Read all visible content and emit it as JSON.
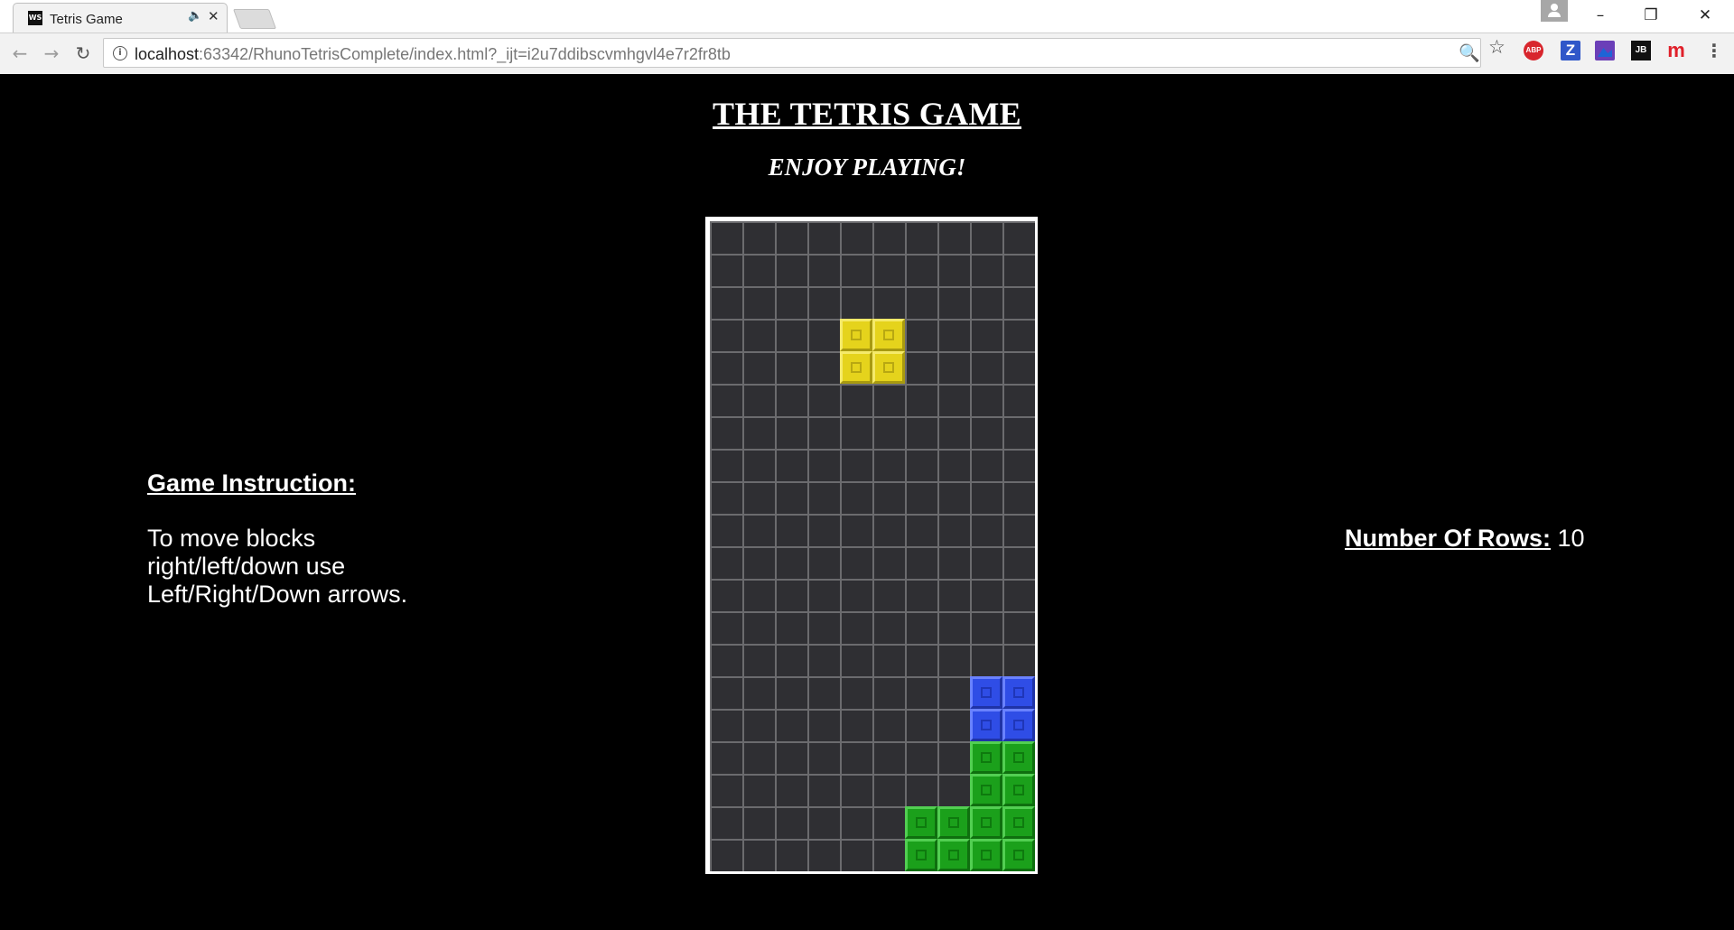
{
  "browser": {
    "tab_title": "Tetris Game",
    "tab_favicon_text": "WS",
    "url_host": "localhost",
    "url_rest": ":63342/RhunoTetrisComplete/index.html?_ijt=i2u7ddibscvmhgvl4e7r2fr8tb",
    "extensions": [
      "ABP",
      "Z",
      "",
      "JB",
      "m"
    ]
  },
  "page": {
    "title": "THE TETRIS GAME",
    "subtitle": "ENJOY PLAYING!",
    "instructions": {
      "heading": "Game Instruction:",
      "text": "To move blocks right/left/down use Left/Right/Down arrows."
    },
    "rows": {
      "label": "Number Of Rows:",
      "value": "10"
    }
  },
  "board": {
    "columns": 10,
    "rows": 20,
    "colors": {
      "yellow": "#e5d31c",
      "blue": "#2f4de6",
      "green": "#1ba01b",
      "grid": "#2f2f33",
      "grid_lines": "#6b6b6e"
    },
    "blocks": [
      {
        "row": 3,
        "col": 4,
        "color": "yellow"
      },
      {
        "row": 3,
        "col": 5,
        "color": "yellow"
      },
      {
        "row": 4,
        "col": 4,
        "color": "yellow"
      },
      {
        "row": 4,
        "col": 5,
        "color": "yellow"
      },
      {
        "row": 14,
        "col": 8,
        "color": "blue"
      },
      {
        "row": 14,
        "col": 9,
        "color": "blue"
      },
      {
        "row": 15,
        "col": 8,
        "color": "blue"
      },
      {
        "row": 15,
        "col": 9,
        "color": "blue"
      },
      {
        "row": 16,
        "col": 8,
        "color": "green"
      },
      {
        "row": 16,
        "col": 9,
        "color": "green"
      },
      {
        "row": 17,
        "col": 8,
        "color": "green"
      },
      {
        "row": 17,
        "col": 9,
        "color": "green"
      },
      {
        "row": 18,
        "col": 6,
        "color": "green"
      },
      {
        "row": 18,
        "col": 7,
        "color": "green"
      },
      {
        "row": 18,
        "col": 8,
        "color": "green"
      },
      {
        "row": 18,
        "col": 9,
        "color": "green"
      },
      {
        "row": 19,
        "col": 6,
        "color": "green"
      },
      {
        "row": 19,
        "col": 7,
        "color": "green"
      },
      {
        "row": 19,
        "col": 8,
        "color": "green"
      },
      {
        "row": 19,
        "col": 9,
        "color": "green"
      }
    ]
  }
}
